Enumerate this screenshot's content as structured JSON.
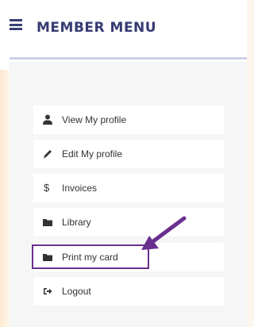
{
  "header": {
    "title": "MEMBER MENU",
    "menu_icon": "hamburger-icon"
  },
  "menu": {
    "items": [
      {
        "label": "View My profile",
        "icon": "user-icon"
      },
      {
        "label": "Edit My profile",
        "icon": "pencil-icon"
      },
      {
        "label": "Invoices",
        "icon": "dollar-icon"
      },
      {
        "label": "Library",
        "icon": "folder-icon"
      },
      {
        "label": "Print my card",
        "icon": "folder-icon",
        "highlighted": true
      },
      {
        "label": "Logout",
        "icon": "logout-icon"
      }
    ]
  },
  "annotation": {
    "arrow_icon": "arrow-icon",
    "highlight_color": "#6a2f8e"
  },
  "colors": {
    "accent": "#363b73",
    "background": "#fdf6ec",
    "panel": "#f6f6f7"
  }
}
